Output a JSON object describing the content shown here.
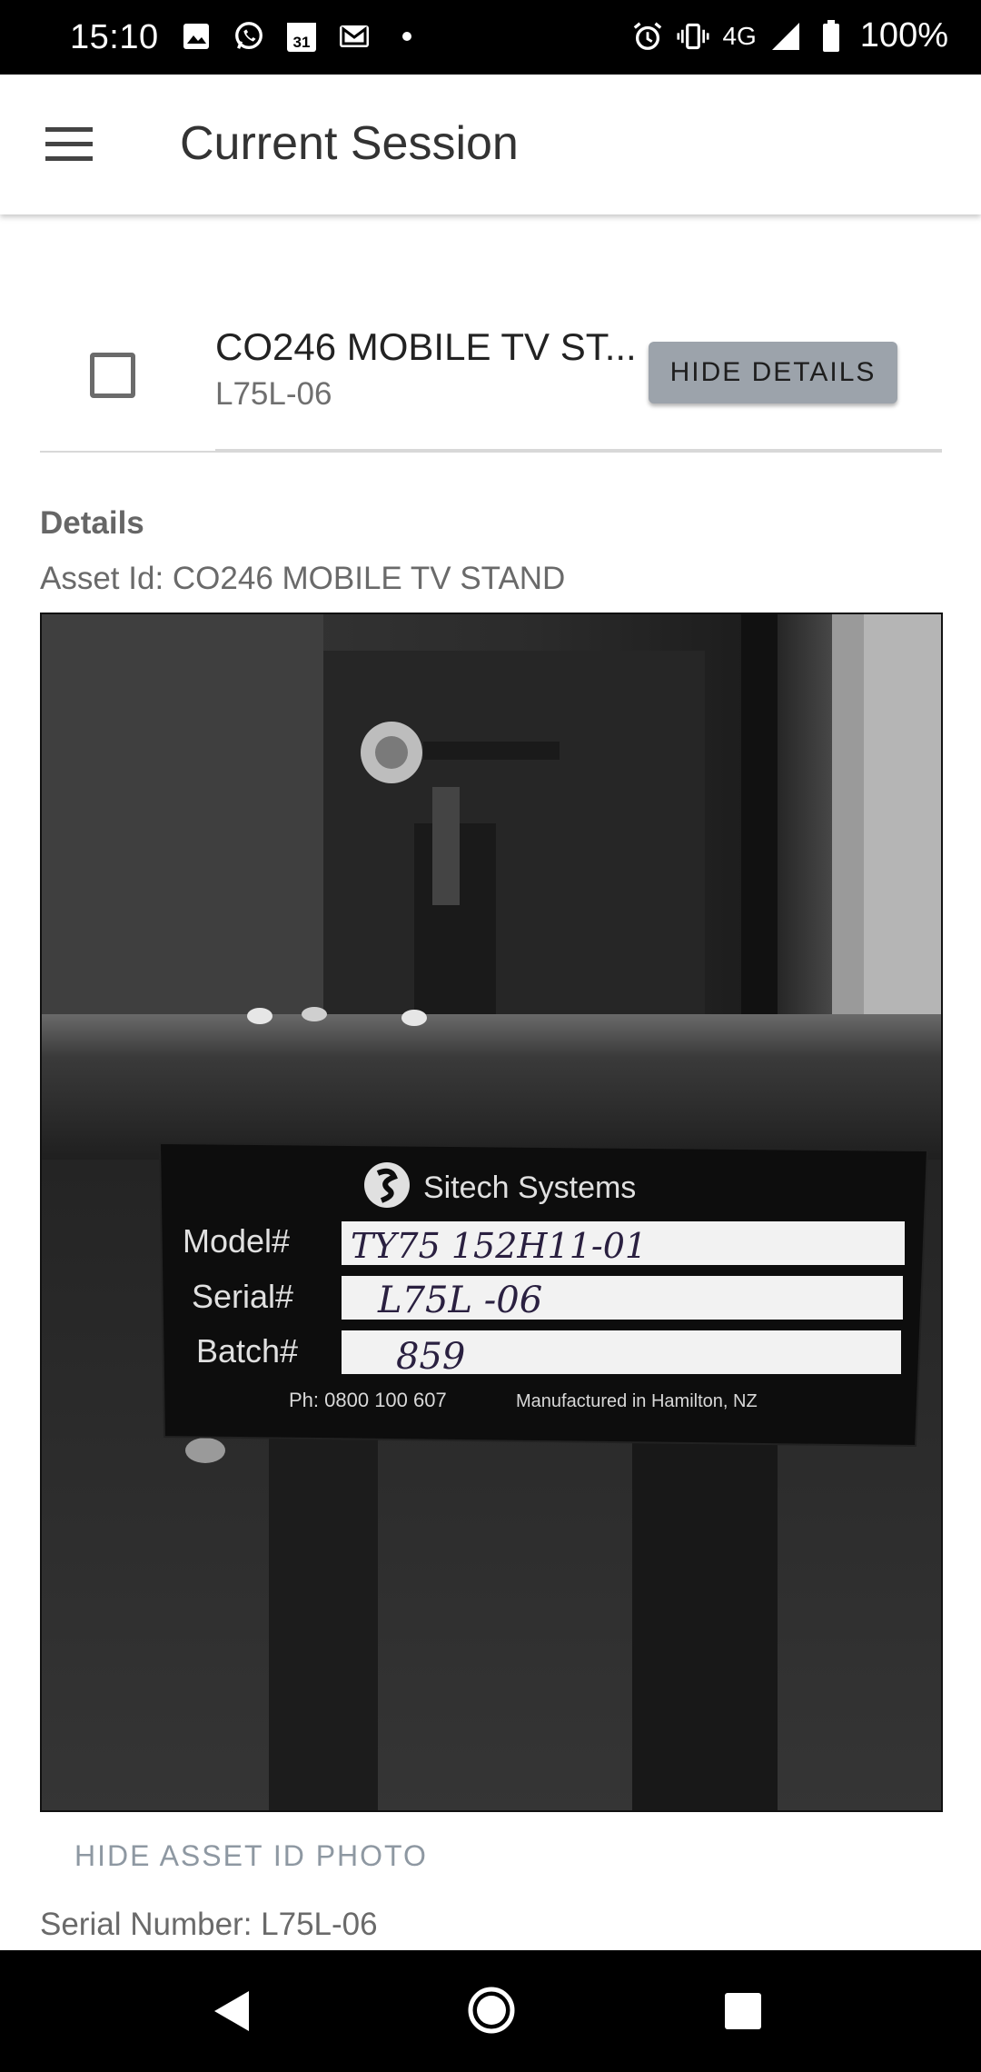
{
  "status_bar": {
    "time": "15:10",
    "left_icons": [
      "image-icon",
      "whatsapp-icon",
      "calendar-icon",
      "gmail-icon",
      "dot-icon"
    ],
    "calendar_day": "31",
    "network": "4G",
    "battery": "100%"
  },
  "app_bar": {
    "title": "Current Session"
  },
  "item": {
    "title": "CO246 MOBILE TV ST...",
    "subtitle": "L75L-06",
    "hide_details_label": "HIDE DETAILS"
  },
  "details": {
    "heading": "Details",
    "asset_id_line": "Asset Id: CO246 MOBILE TV STAND",
    "photo": {
      "brand": "Sitech Systems",
      "model_label": "Model#",
      "model_value": "TY75   152H11-01",
      "serial_label": "Serial#",
      "serial_value": "L75L -06",
      "batch_label": "Batch#",
      "batch_value": "859",
      "phone": "Ph: 0800 100 607",
      "manufactured": "Manufactured in Hamilton, NZ"
    },
    "hide_photo_label": "HIDE ASSET ID PHOTO",
    "serial_line": "Serial Number: L75L-06"
  },
  "colors": {
    "button_gray": "#9ca3ab",
    "text_button": "#8e98a2"
  }
}
